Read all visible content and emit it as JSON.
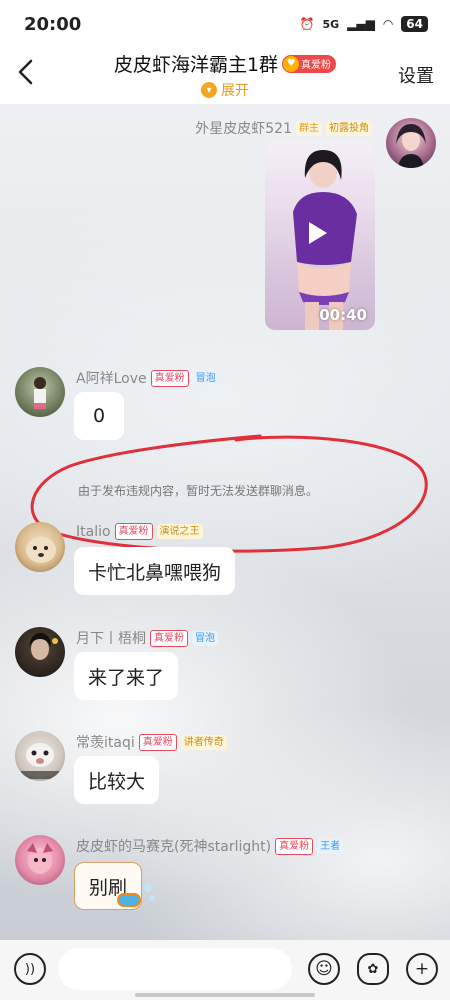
{
  "status_bar": {
    "time": "20:00",
    "network": "5G",
    "battery": "64"
  },
  "header": {
    "title": "皮皮虾海洋霸主1群",
    "badge": "真爱粉",
    "expand_label": "展开",
    "settings_label": "设置"
  },
  "messages": [
    {
      "sender": "外星皮皮虾521",
      "tags": [
        "群主",
        "初露投角"
      ],
      "type": "video",
      "duration": "00:40"
    },
    {
      "sender": "A阿祥Love",
      "tags": [
        "真爱粉",
        "冒泡"
      ],
      "text": "0"
    },
    {
      "sender": "Italio",
      "tags": [
        "真爱粉",
        "演说之王"
      ],
      "text": "卡忙北鼻嘿喂狗"
    },
    {
      "sender": "月下丨梧桐",
      "tags": [
        "真爱粉",
        "冒泡"
      ],
      "text": "来了来了"
    },
    {
      "sender": "常羡itaqi",
      "tags": [
        "真爱粉",
        "讲者传奇"
      ],
      "text": "比较大"
    },
    {
      "sender": "皮皮虾的马赛克(死神starlight)",
      "tags": [
        "真爱粉",
        "王者"
      ],
      "text": "别刷"
    }
  ],
  "system_message": "由于发布违规内容，暂时无法发送群聊消息。",
  "input": {
    "placeholder": ""
  },
  "colors": {
    "annotation": "#e0303a",
    "accent": "#f2a623",
    "tag_red": "#e84a5f"
  }
}
